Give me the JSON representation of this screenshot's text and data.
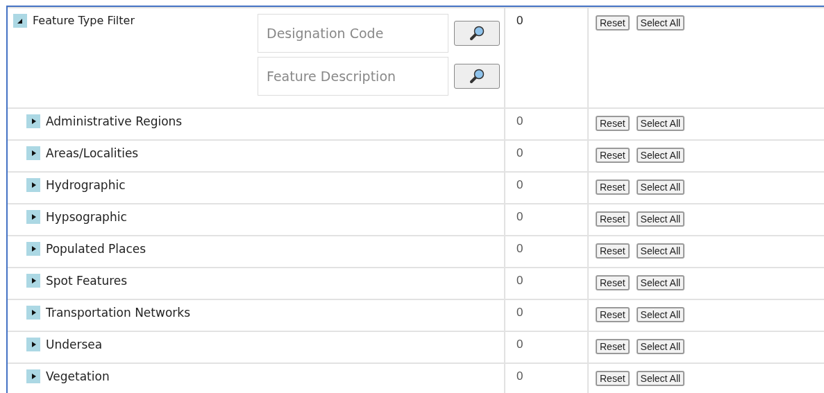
{
  "filter": {
    "label": "Feature Type Filter",
    "expanded": true,
    "count": "0",
    "fields": [
      {
        "placeholder": "Designation Code"
      },
      {
        "placeholder": "Feature Description"
      }
    ],
    "buttons": [
      "Reset",
      "Select All"
    ]
  },
  "rows": [
    {
      "label": "Administrative Regions",
      "expanded": false,
      "count": "0",
      "buttons": [
        "Reset",
        "Select All"
      ]
    },
    {
      "label": "Areas/Localities",
      "expanded": false,
      "count": "0",
      "buttons": [
        "Reset",
        "Select All"
      ]
    },
    {
      "label": "Hydrographic",
      "expanded": false,
      "count": "0",
      "buttons": [
        "Reset",
        "Select All"
      ]
    },
    {
      "label": "Hypsographic",
      "expanded": false,
      "count": "0",
      "buttons": [
        "Reset",
        "Select All"
      ]
    },
    {
      "label": "Populated Places",
      "expanded": false,
      "count": "0",
      "buttons": [
        "Reset",
        "Select All"
      ]
    },
    {
      "label": "Spot Features",
      "expanded": false,
      "count": "0",
      "buttons": [
        "Reset",
        "Select All"
      ]
    },
    {
      "label": "Transportation Networks",
      "expanded": false,
      "count": "0",
      "buttons": [
        "Reset",
        "Select All"
      ]
    },
    {
      "label": "Undersea",
      "expanded": false,
      "count": "0",
      "buttons": [
        "Reset",
        "Select All"
      ]
    },
    {
      "label": "Vegetation",
      "expanded": false,
      "count": "0",
      "buttons": [
        "Reset",
        "Select All"
      ]
    }
  ]
}
